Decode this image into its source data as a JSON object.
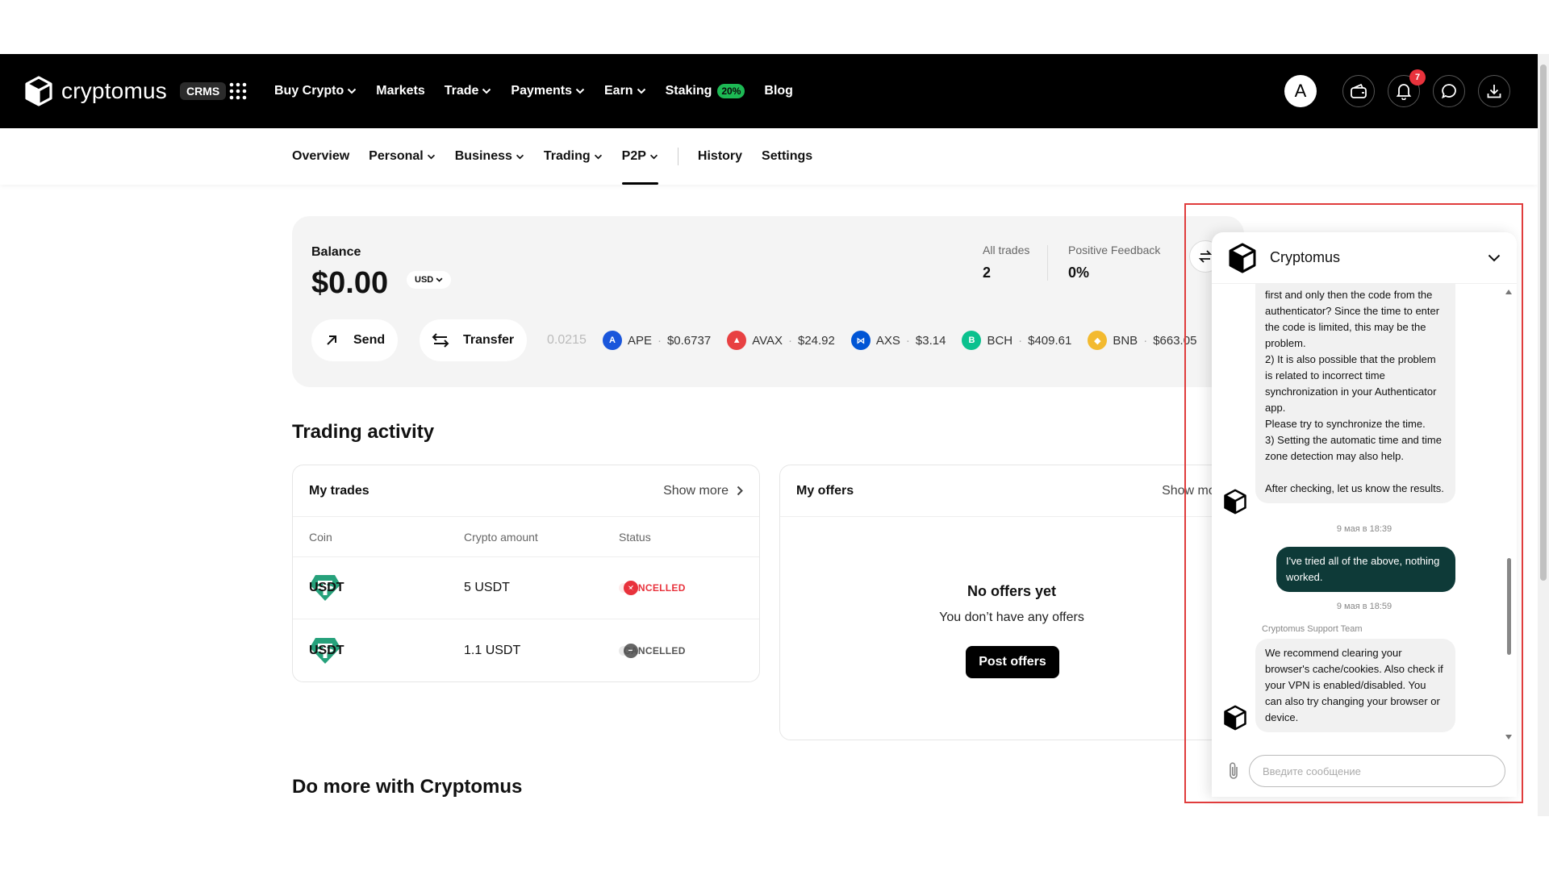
{
  "topbar": {
    "brand": "cryptomus",
    "badge": "CRMS",
    "nav": [
      {
        "label": "Buy Crypto",
        "dropdown": true
      },
      {
        "label": "Markets",
        "dropdown": false
      },
      {
        "label": "Trade",
        "dropdown": true
      },
      {
        "label": "Payments",
        "dropdown": true
      },
      {
        "label": "Earn",
        "dropdown": true
      },
      {
        "label": "Staking",
        "dropdown": false,
        "badge": "20%"
      },
      {
        "label": "Blog",
        "dropdown": false
      }
    ],
    "avatar_letter": "A",
    "notifications_count": "7"
  },
  "subnav": {
    "items": [
      {
        "label": "Overview"
      },
      {
        "label": "Personal"
      },
      {
        "label": "Business"
      },
      {
        "label": "Trading"
      },
      {
        "label": "P2P"
      },
      {
        "label": "History"
      },
      {
        "label": "Settings"
      }
    ]
  },
  "balance": {
    "label": "Balance",
    "amount": "$0.00",
    "currency": "USD",
    "all_trades_label": "All trades",
    "all_trades_value": "2",
    "feedback_label": "Positive Feedback",
    "feedback_value": "0%",
    "send_label": "Send",
    "transfer_label": "Transfer",
    "ticker_partial": "0.0215",
    "ticker": [
      {
        "symbol": "APE",
        "price": "$0.6737",
        "color": "#1a56db",
        "icon": "ape-icon"
      },
      {
        "symbol": "AVAX",
        "price": "$24.92",
        "color": "#e84142",
        "icon": "avax-icon"
      },
      {
        "symbol": "AXS",
        "price": "$3.14",
        "color": "#0055d5",
        "icon": "axs-icon"
      },
      {
        "symbol": "BCH",
        "price": "$409.61",
        "color": "#0ac18e",
        "icon": "bch-icon"
      },
      {
        "symbol": "BNB",
        "price": "$663.05",
        "color": "#f3ba2f",
        "icon": "bnb-icon"
      }
    ]
  },
  "trading": {
    "title": "Trading activity",
    "my_trades": {
      "title": "My trades",
      "show_more": "Show more",
      "columns": [
        "Coin",
        "Crypto amount",
        "Status"
      ],
      "rows": [
        {
          "coin": "USDT",
          "amount": "5 USDT",
          "status": "CANCELLED",
          "status_color": "#e8323c"
        },
        {
          "coin": "USDT",
          "amount": "1.1 USDT",
          "status": "CANCELLED",
          "status_color": "#777777"
        }
      ]
    },
    "my_offers": {
      "title": "My offers",
      "show_more": "Show more",
      "empty_title": "No offers yet",
      "empty_sub": "You don’t have any offers",
      "post_button": "Post offers"
    }
  },
  "do_more_title": "Do more with Cryptomus",
  "chat": {
    "title": "Cryptomus",
    "messages": [
      {
        "type": "in",
        "text": "first and only then the code from the authenticator? Since the time to enter the code is limited, this may be the problem.\n2) It is also possible that the problem is related to incorrect time synchronization in your Authenticator app.\nPlease try to synchronize the time.\n3) Setting the automatic time and time zone detection may also help.\n\nAfter checking, let us know the results."
      },
      {
        "type": "ts",
        "text": "9 мая в 18:39"
      },
      {
        "type": "out",
        "text": "I've tried all of the above, nothing worked."
      },
      {
        "type": "ts",
        "text": "9 мая в 18:59"
      },
      {
        "type": "sender",
        "text": "Cryptomus Support Team"
      },
      {
        "type": "in",
        "text": "We recommend clearing your browser's cache/cookies. Also check if your VPN is enabled/disabled. You can also try changing your browser or device."
      }
    ],
    "input_placeholder": "Введите сообщение"
  },
  "colors": {
    "accent": "#1db954",
    "chat_outgoing": "#0e3a38",
    "highlight_outline": "#e03c3c"
  }
}
